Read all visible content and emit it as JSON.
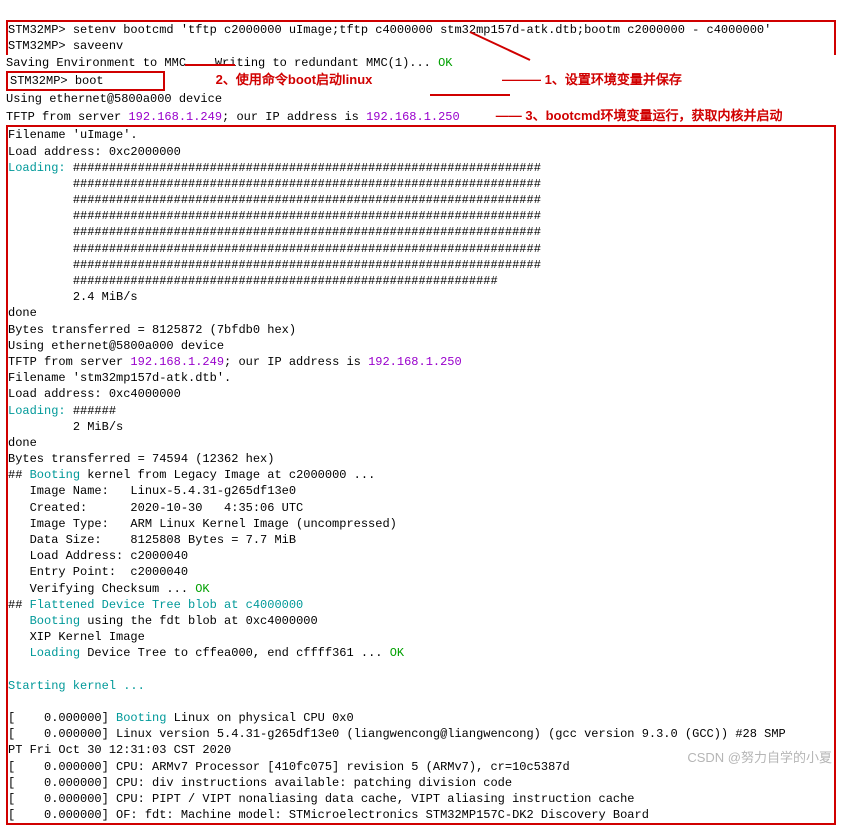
{
  "cmd": {
    "prompt": "STM32MP>",
    "setenv": "setenv bootcmd 'tftp c2000000 uImage;tftp c4000000 stm32mp157d-atk.dtb;bootm c2000000 - c4000000'",
    "saveenv": "saveenv",
    "saving_prefix": "Saving Environment to MMC... Writing to redundant MMC(1)... ",
    "ok": "OK",
    "boot": "boot",
    "using_eth": "Using ethernet@5800a000 device",
    "tftp_prefix": "TFTP from server ",
    "server_ip": "192.168.1.249",
    "tftp_mid": "; our IP address is ",
    "our_ip": "192.168.1.250"
  },
  "anno": {
    "a1": "1、设置环境变量并保存",
    "a2": "2、使用命令boot启动linux",
    "a3": "3、bootcmd环境变量运行，获取内核并启动"
  },
  "load": {
    "filename": "Filename 'uImage'.",
    "addr1": "Load address: 0xc2000000",
    "loading_label": "Loading:",
    "hashline": "#################################################################",
    "hashshort": "###########################################################",
    "speed1": "2.4 MiB/s",
    "done": "done",
    "bytes1": "Bytes transferred = 8125872 (7bfdb0 hex)",
    "using_eth": "Using ethernet@5800a000 device",
    "filename2": "Filename 'stm32mp157d-atk.dtb'.",
    "addr2": "Load address: 0xc4000000",
    "hash6": "######",
    "speed2": "2 MiB/s",
    "bytes2": "Bytes transferred = 74594 (12362 hex)"
  },
  "boot": {
    "booting": "Booting",
    "legacy": " kernel from Legacy Image at c2000000 ...",
    "image_name": "   Image Name:   Linux-5.4.31-g265df13e0",
    "created": "   Created:      2020-10-30   4:35:06 UTC",
    "image_type": "   Image Type:   ARM Linux Kernel Image (uncompressed)",
    "data_size": "   Data Size:    8125808 Bytes = 7.7 MiB",
    "load_addr": "   Load Address: c2000040",
    "entry": "   Entry Point:  c2000040",
    "verify": "   Verifying Checksum ... ",
    "flattened": " Flattened Device Tree blob at c4000000",
    "booting_fdt": " using the fdt blob at 0xc4000000",
    "xip": "   XIP Kernel Image",
    "loading": "Loading",
    "devtree": " Device Tree to cffea000, end cffff361 ... ",
    "starting": "Starting kernel ..."
  },
  "kernel": {
    "l0a": "[    0.000000] ",
    "booting_line": " Linux on physical CPU 0x0",
    "version": "[    0.000000] Linux version 5.4.31-g265df13e0 (liangwencong@liangwencong) (gcc version 9.3.0 (GCC)) #28 SMP ",
    "version2": "PT Fri Oct 30 12:31:03 CST 2020",
    "cpu1": "[    0.000000] CPU: ARMv7 Processor [410fc075] revision 5 (ARMv7), cr=10c5387d",
    "cpu2": "[    0.000000] CPU: div instructions available: patching division code",
    "cpu3": "[    0.000000] CPU: PIPT / VIPT nonaliasing data cache, VIPT aliasing instruction cache",
    "of": "[    0.000000] OF: fdt: Machine model: STMicroelectronics STM32MP157C-DK2 Discovery Board"
  },
  "watermark": "CSDN @努力自学的小夏"
}
